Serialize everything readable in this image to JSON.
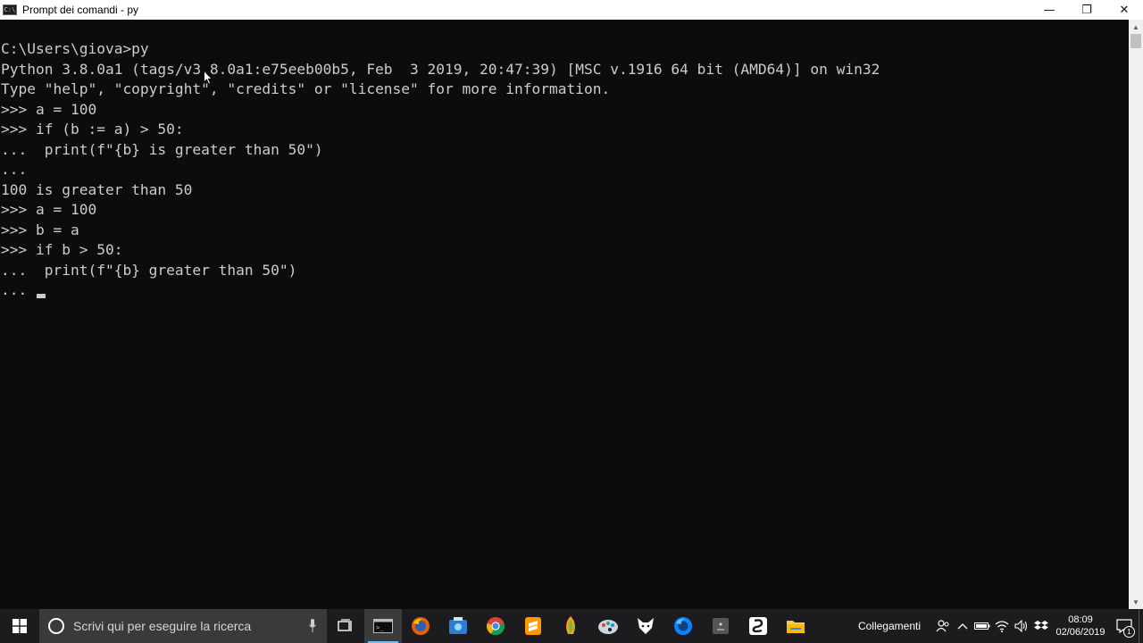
{
  "window": {
    "title": "Prompt dei comandi - py",
    "icon_text": "C:\\",
    "controls": {
      "minimize": "—",
      "maximize": "❐",
      "close": "✕"
    }
  },
  "console": {
    "lines": [
      "C:\\Users\\giova>py",
      "Python 3.8.0a1 (tags/v3.8.0a1:e75eeb00b5, Feb  3 2019, 20:47:39) [MSC v.1916 64 bit (AMD64)] on win32",
      "Type \"help\", \"copyright\", \"credits\" or \"license\" for more information.",
      ">>> a = 100",
      ">>> if (b := a) > 50:",
      "...  print(f\"{b} is greater than 50\")",
      "...",
      "100 is greater than 50",
      ">>> a = 100",
      ">>> b = a",
      ">>> if b > 50:",
      "...  print(f\"{b} greater than 50\")",
      "... "
    ]
  },
  "taskbar": {
    "search_placeholder": "Scrivi qui per eseguire la ricerca",
    "apps": [
      {
        "name": "task-view-icon"
      },
      {
        "name": "cmd-icon",
        "active": true
      },
      {
        "name": "firefox-icon"
      },
      {
        "name": "app-store-icon"
      },
      {
        "name": "chrome-icon"
      },
      {
        "name": "sublime-text-icon"
      },
      {
        "name": "fl-studio-icon"
      },
      {
        "name": "paint-icon"
      },
      {
        "name": "fox-app-icon"
      },
      {
        "name": "firefox-developer-icon"
      },
      {
        "name": "disk-utility-icon"
      },
      {
        "name": "steam-icon"
      },
      {
        "name": "file-explorer-icon"
      }
    ],
    "tray": {
      "links_label": "Collegamenti",
      "time": "08:09",
      "date": "02/06/2019",
      "notifications": "1"
    }
  },
  "colors": {
    "console_bg": "#0c0c0c",
    "console_text": "#cccccc",
    "taskbar_bg": "#1c1c1e",
    "accent": "#76b9ed"
  }
}
